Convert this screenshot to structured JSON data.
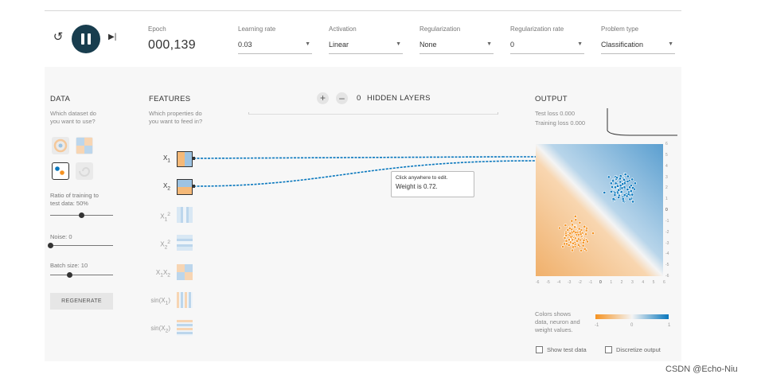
{
  "controls": {
    "epoch_label": "Epoch",
    "epoch_value": "000,139",
    "learning_rate": {
      "label": "Learning rate",
      "value": "0.03"
    },
    "activation": {
      "label": "Activation",
      "value": "Linear"
    },
    "regularization": {
      "label": "Regularization",
      "value": "None"
    },
    "regularization_rate": {
      "label": "Regularization rate",
      "value": "0"
    },
    "problem_type": {
      "label": "Problem type",
      "value": "Classification"
    }
  },
  "data_panel": {
    "title": "DATA",
    "subtitle_1": "Which dataset do",
    "subtitle_2": "you want to use?",
    "ratio_label_1": "Ratio of training to",
    "ratio_label_2": "test data:  50%",
    "ratio_value": 50,
    "noise_label": "Noise:  0",
    "noise_value": 0,
    "batch_label": "Batch size:  10",
    "batch_value": 10,
    "regenerate_label": "REGENERATE"
  },
  "features_panel": {
    "title": "FEATURES",
    "subtitle_1": "Which properties do",
    "subtitle_2": "you want to feed in?",
    "features": [
      "X1",
      "X2",
      "X1²",
      "X2²",
      "X1X2",
      "sin(X1)",
      "sin(X2)"
    ]
  },
  "hidden_layers": {
    "count": "0",
    "label": "HIDDEN LAYERS",
    "add": "+",
    "remove": "–"
  },
  "tooltip": {
    "line1": "Click anywhere to edit.",
    "line2": "Weight is 0.72."
  },
  "output_panel": {
    "title": "OUTPUT",
    "test_loss": "Test loss 0.000",
    "training_loss": "Training loss 0.000",
    "x_ticks": [
      "-6",
      "-5",
      "-4",
      "-3",
      "-2",
      "-1",
      "0",
      "1",
      "2",
      "3",
      "4",
      "5",
      "6"
    ],
    "y_ticks": [
      "6",
      "5",
      "4",
      "3",
      "2",
      "1",
      "0",
      "-1",
      "-2",
      "-3",
      "-4",
      "-5",
      "-6"
    ],
    "legend_text_1": "Colors shows",
    "legend_text_2": "data, neuron and",
    "legend_text_3": "weight values.",
    "legend_min": "-1",
    "legend_mid": "0",
    "legend_max": "1",
    "show_test_data": "Show test data",
    "discretize_output": "Discretize output"
  },
  "colors": {
    "orange": "#f59322",
    "blue": "#0877bd",
    "play_button": "#183d4e"
  },
  "watermark": "CSDN @Echo-Niu"
}
